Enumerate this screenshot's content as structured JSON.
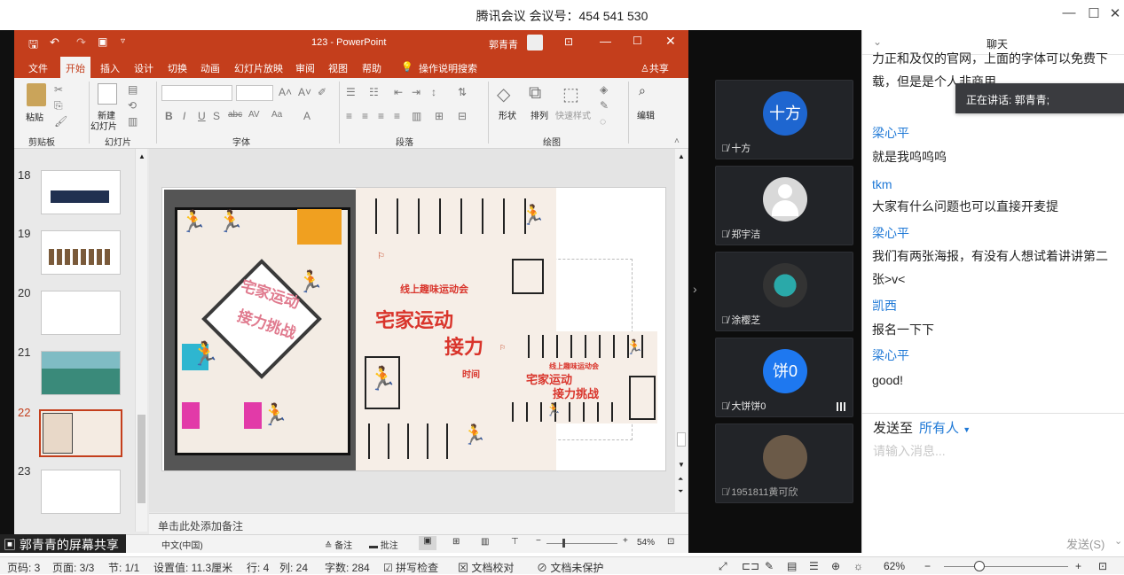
{
  "meeting": {
    "title": "腾讯会议 会议号：454 541 530",
    "share_label": "郭青青的屏幕共享"
  },
  "ppt": {
    "window_title": "123 - PowerPoint",
    "user": "郭青青",
    "tabs": [
      "文件",
      "开始",
      "插入",
      "设计",
      "切换",
      "动画",
      "幻灯片放映",
      "审阅",
      "视图",
      "帮助"
    ],
    "active_tab": "开始",
    "tell_me": "操作说明搜索",
    "share": "共享",
    "ribbon": {
      "paste": "粘贴",
      "new_slide_1": "新建",
      "new_slide_2": "幻灯片",
      "shape": "形状",
      "arrange": "排列",
      "quick_style": "快速样式",
      "edit": "编辑",
      "groups": [
        "剪贴板",
        "幻灯片",
        "字体",
        "段落",
        "绘图"
      ]
    },
    "thumbnails": [
      {
        "num": "18"
      },
      {
        "num": "19"
      },
      {
        "num": "20"
      },
      {
        "num": "21"
      },
      {
        "num": "22"
      },
      {
        "num": "23"
      }
    ],
    "notes_placeholder": "单击此处添加备注",
    "status": {
      "lang": "中文(中国)",
      "notes": "备注",
      "comments": "批注",
      "zoom": "54%"
    },
    "slide": {
      "poster1_title": "宅家运动",
      "poster1_sub": "接力挑战",
      "poster2_event": "线上趣味运动会",
      "poster2_title": "宅家运动",
      "poster2_sub": "接力",
      "poster3_event": "线上趣味运动会",
      "poster3_title": "宅家运动",
      "poster3_sub": "接力挑战",
      "time_label": "时间"
    }
  },
  "participants": [
    {
      "name": "十方",
      "avatar_text": "十方",
      "color": "#1e66d0"
    },
    {
      "name": "郑宇洁",
      "avatar_text": "",
      "color": "#d9d9d9"
    },
    {
      "name": "涂樱芝",
      "avatar_text": "",
      "color": "#555"
    },
    {
      "name": "大饼饼0",
      "avatar_text": "饼0",
      "color": "#1e78f0"
    },
    {
      "name": "1951811黄可欣",
      "avatar_text": "",
      "color": "#6b5a48"
    }
  ],
  "chat": {
    "title": "聊天",
    "top_msg_1": "力正和及仅的官网，上面的字体可以免费下",
    "top_msg_2": "载，但是是个人非商用",
    "speaking": "正在讲话: 郭青青;",
    "messages": [
      {
        "name": "梁心平",
        "text": "就是我呜呜呜"
      },
      {
        "name": "tkm",
        "text": "大家有什么问题也可以直接开麦提"
      },
      {
        "name": "梁心平",
        "text": "我们有两张海报，有没有人想试着讲讲第二"
      },
      {
        "name": "",
        "text": "张>v<"
      },
      {
        "name": "凯西",
        "text": "报名一下下"
      },
      {
        "name": "梁心平",
        "text": "good!"
      }
    ],
    "send_to_label": "发送至",
    "send_to_target": "所有人",
    "input_placeholder": "请输入消息...",
    "send_button": "发送(S)"
  },
  "word_status": {
    "page_code": "页码: 3",
    "page": "页面: 3/3",
    "section": "节: 1/1",
    "setting": "设置值: 11.3厘米",
    "row": "行: 4",
    "col": "列: 24",
    "words": "字数: 284",
    "spell": "拼写检查",
    "proof": "文档校对",
    "protect": "文档未保护",
    "zoom": "62%"
  },
  "colors": {
    "ppt_red": "#c43e1c",
    "chat_name_blue": "#1e78d6",
    "poster_orange": "#e07a2e",
    "poster_red": "#d9342b",
    "poster_blue": "#2e8fc4",
    "poster_magenta": "#e23aa8"
  }
}
